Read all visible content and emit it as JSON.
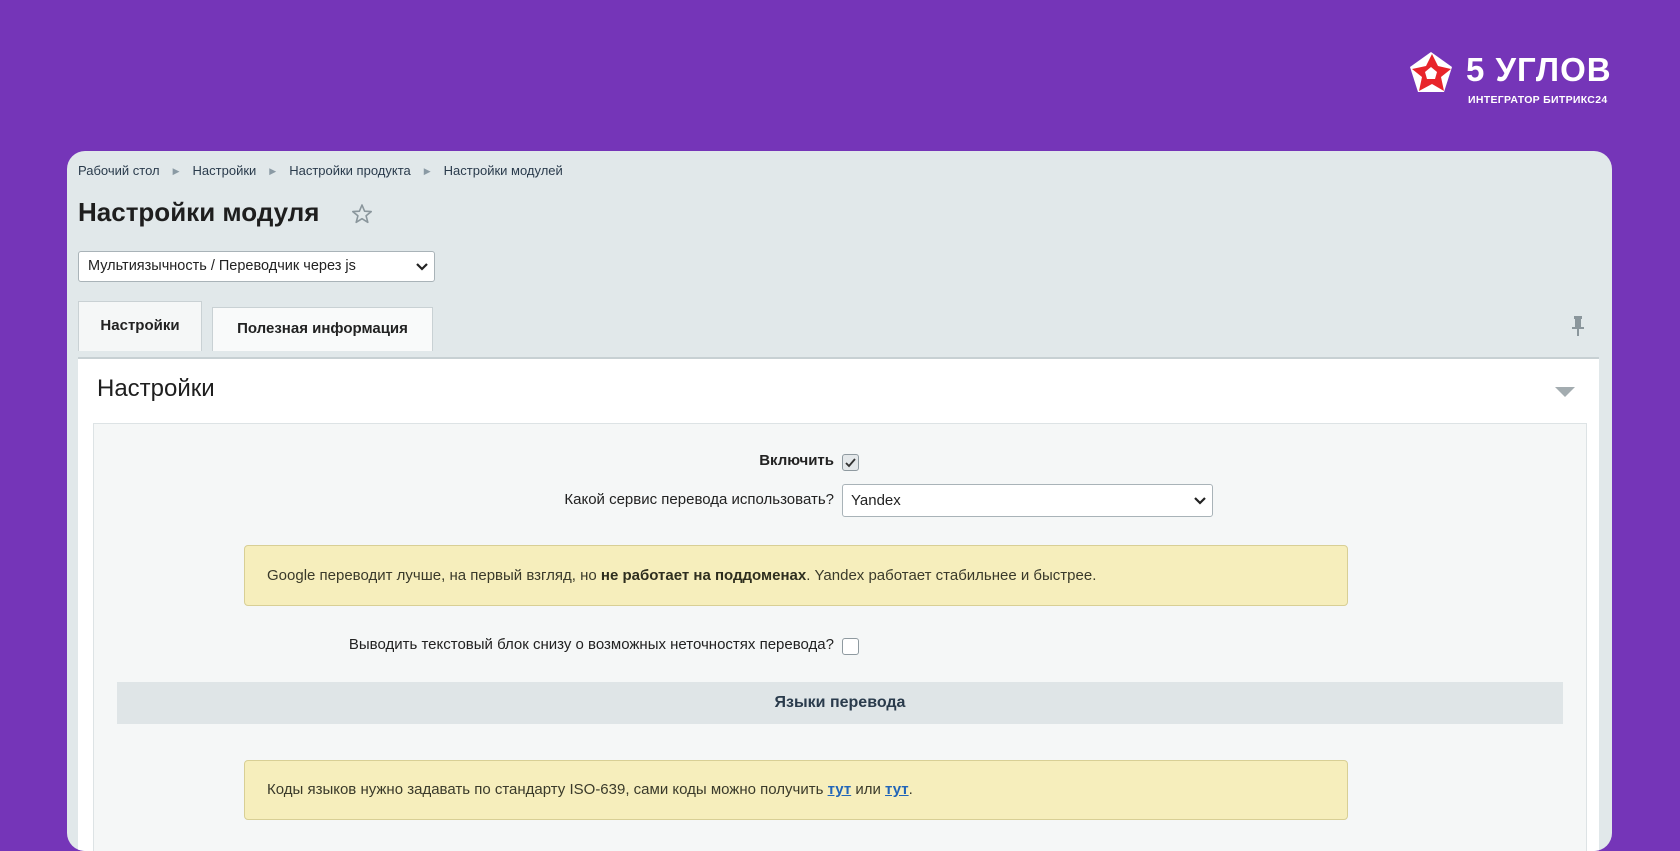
{
  "logo": {
    "title": "5 УГЛОВ",
    "subtitle": "ИНТЕГРАТОР БИТРИКС24",
    "icon": "star-pentagon-logo",
    "colors": {
      "mark": "#e8242a",
      "text": "#ffffff"
    }
  },
  "colors": {
    "background": "#7535b8",
    "panel": "#e1e8ea",
    "notice": "#f6eebc",
    "link": "#2165b8"
  },
  "breadcrumb": [
    "Рабочий стол",
    "Настройки",
    "Настройки продукта",
    "Настройки модулей"
  ],
  "page_title": "Настройки модуля",
  "module_select": {
    "value": "Мультиязычность / Переводчик через js"
  },
  "tabs": [
    {
      "label": "Настройки",
      "active": true
    },
    {
      "label": "Полезная информация",
      "active": false
    }
  ],
  "section": {
    "title": "Настройки",
    "enable": {
      "label": "Включить",
      "checked": true
    },
    "service": {
      "label": "Какой сервис перевода использовать?",
      "value": "Yandex"
    },
    "notice1": {
      "before": "Google переводит лучше, на первый взгляд, но ",
      "bold": "не работает на поддоменах",
      "after": ". Yandex работает стабильнее и быстрее."
    },
    "inaccuracy": {
      "label": "Выводить текстовый блок снизу о возможных неточностях перевода?",
      "checked": false
    },
    "languages_header": "Языки перевода",
    "notice2": {
      "before": "Коды языков нужно задавать по стандарту ISO-639, сами коды можно получить ",
      "link1": "тут",
      "middle": " или ",
      "link2": "тут",
      "after": "."
    }
  }
}
